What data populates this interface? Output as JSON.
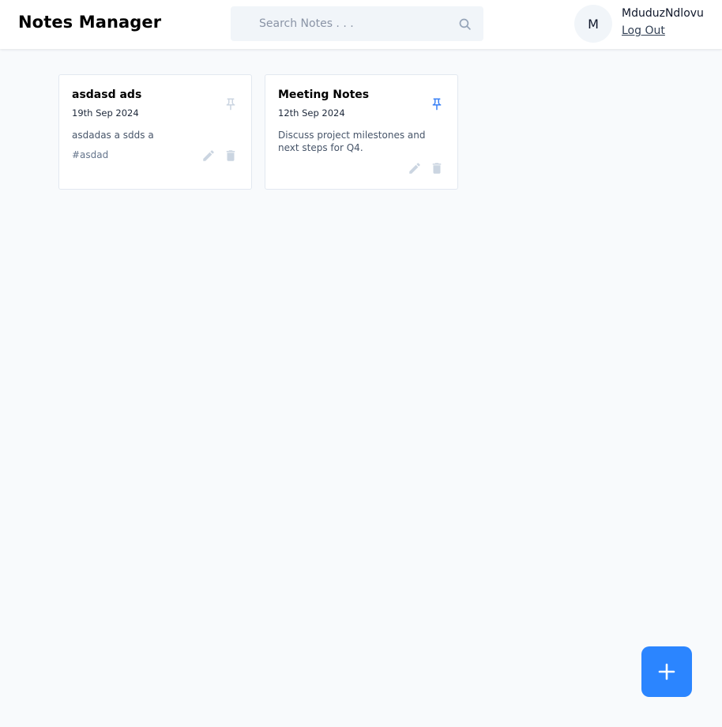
{
  "app": {
    "title": "Notes Manager"
  },
  "search": {
    "placeholder": "Search Notes . . ."
  },
  "user": {
    "initial": "M",
    "name": "MduduzNdlovu",
    "logout_label": "Log Out"
  },
  "notes": [
    {
      "title": "asdasd ads",
      "date": "19th Sep 2024",
      "content": "asdadas a sdds a",
      "tags": "#asdad",
      "pinned": false
    },
    {
      "title": "Meeting Notes",
      "date": "12th Sep 2024",
      "content": "Discuss project milestones and next steps for Q4.",
      "tags": "",
      "pinned": true
    }
  ],
  "add_button": {
    "icon": "plus-icon"
  },
  "colors": {
    "accent": "#2b85ff",
    "pin_active": "#3b82f6",
    "pin_inactive": "#cbd5e1",
    "action_icon": "#cbd5e1",
    "background": "#f8fafc"
  }
}
